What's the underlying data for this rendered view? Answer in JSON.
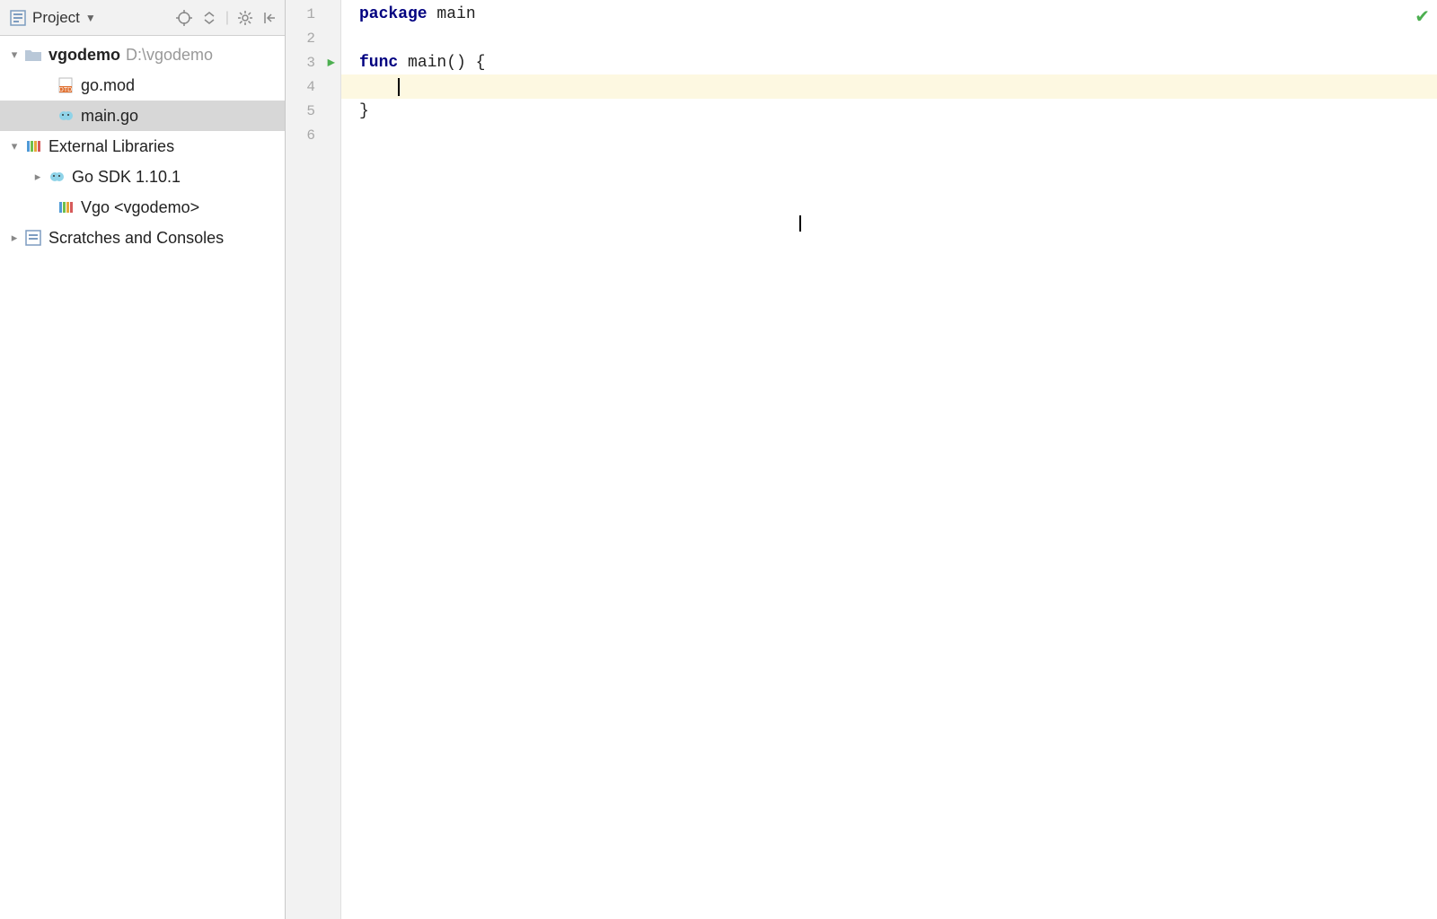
{
  "sidebar": {
    "title": "Project",
    "tree": {
      "root": {
        "name": "vgodemo",
        "path": "D:\\vgodemo"
      },
      "files": [
        {
          "name": "go.mod",
          "icon": "dtd",
          "selected": false
        },
        {
          "name": "main.go",
          "icon": "go",
          "selected": true
        }
      ]
    },
    "external_libraries": {
      "label": "External Libraries",
      "items": [
        {
          "label": "Go SDK 1.10.1",
          "icon": "go",
          "expandable": true
        },
        {
          "label": "Vgo <vgodemo>",
          "icon": "lib",
          "expandable": false
        }
      ]
    },
    "scratches": {
      "label": "Scratches and Consoles"
    }
  },
  "editor": {
    "lines": [
      "1",
      "2",
      "3",
      "4",
      "5",
      "6"
    ],
    "code": {
      "l1_kw": "package",
      "l1_id": " main",
      "l3_kw": "func",
      "l3_rest": " main() {",
      "l4_indent": "    ",
      "l5": "}"
    },
    "run_line": 3,
    "caret_line": 4
  }
}
